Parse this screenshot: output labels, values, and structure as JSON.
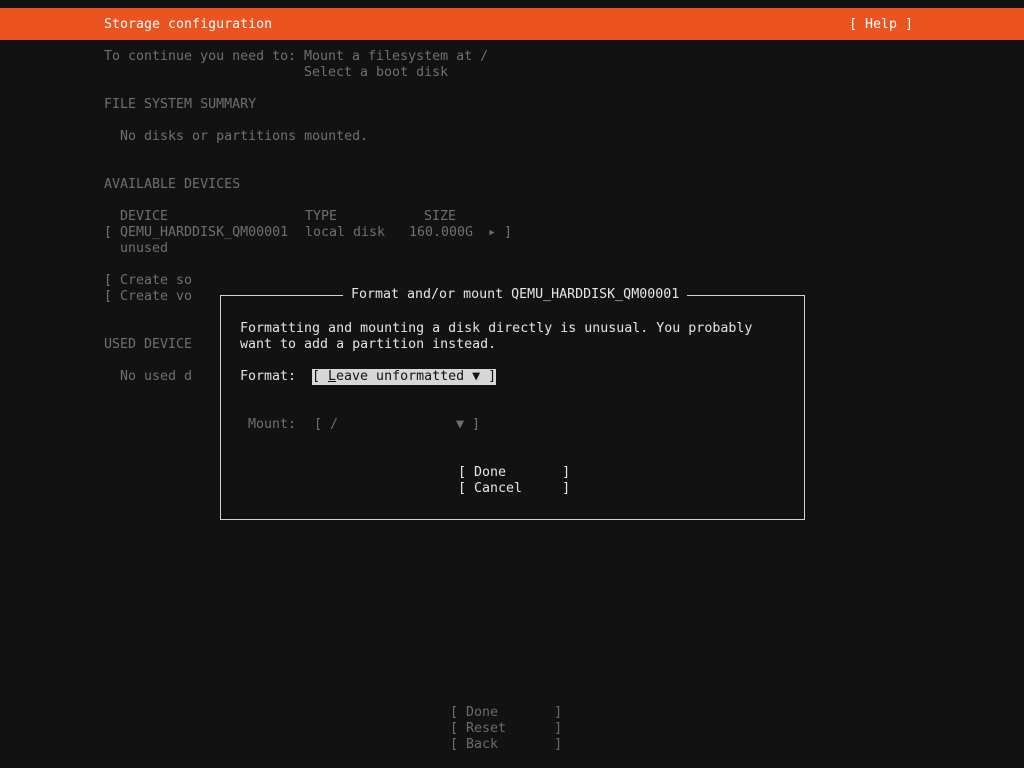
{
  "header": {
    "title": "Storage configuration",
    "help_label": "[ Help ]"
  },
  "requirements": {
    "prefix": "To continue you need to:",
    "item1": "Mount a filesystem at /",
    "item2": "Select a boot disk"
  },
  "fs_summary": {
    "heading": "FILE SYSTEM SUMMARY",
    "empty_text": "No disks or partitions mounted."
  },
  "available_devices": {
    "heading": "AVAILABLE DEVICES",
    "columns": [
      "DEVICE",
      "TYPE",
      "SIZE"
    ],
    "rows": [
      {
        "open_bracket": "[",
        "device": "QEMU_HARDDISK_QM00001",
        "type": "local disk",
        "size": "160.000G",
        "arrow": "▸ ]",
        "status": "unused"
      }
    ],
    "actions": [
      "[ Create so",
      "[ Create vo"
    ]
  },
  "used_devices": {
    "heading": "USED DEVICE",
    "empty_text": "No used d"
  },
  "dialog": {
    "title": "Format and/or mount QEMU_HARDDISK_QM00001",
    "message_line1": "Formatting and mounting a disk directly is unusual. You probably",
    "message_line2": "want to add a partition instead.",
    "format_label": "Format:",
    "format_open": "[ ",
    "format_cursor_char": "L",
    "format_value_rest": "eave unformatted",
    "format_arrow": "▼ ]",
    "mount_label": "Mount:",
    "mount_open": "[ /",
    "mount_arrow": "▼ ]",
    "done_label": "[ Done       ]",
    "cancel_label": "[ Cancel     ]"
  },
  "footer": {
    "done_label": "[ Done       ]",
    "reset_label": "[ Reset      ]",
    "back_label": "[ Back       ]"
  },
  "colors": {
    "accent": "#e95420",
    "background": "#121212"
  }
}
